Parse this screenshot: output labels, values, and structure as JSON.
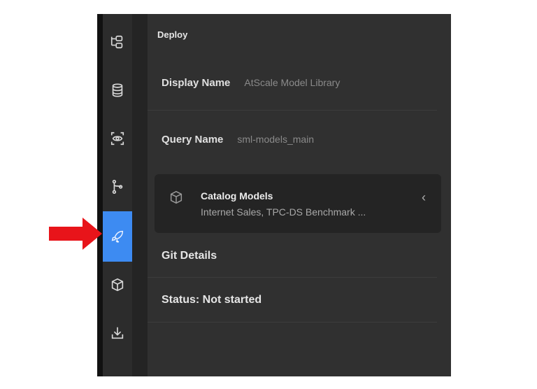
{
  "sidebar": {
    "items": [
      {
        "icon": "diagram-icon",
        "active": false
      },
      {
        "icon": "database-icon",
        "active": false
      },
      {
        "icon": "preview-eye-icon",
        "active": false
      },
      {
        "icon": "git-branch-icon",
        "active": false
      },
      {
        "icon": "rocket-icon",
        "active": true
      },
      {
        "icon": "package-icon",
        "active": false
      },
      {
        "icon": "download-icon",
        "active": false
      }
    ],
    "active_color": "#3d8bf2"
  },
  "panel": {
    "title": "Deploy",
    "fields": [
      {
        "label": "Display Name",
        "value": "AtScale Model Library"
      },
      {
        "label": "Query Name",
        "value": "sml-models_main"
      }
    ],
    "catalog": {
      "title": "Catalog Models",
      "subtitle": "Internet Sales, TPC-DS Benchmark ...",
      "chevron": "‹",
      "icon": "cube-icon"
    },
    "git_details": "Git Details",
    "status": "Status: Not started"
  },
  "annotation": {
    "color": "#e8141a",
    "icon": "red-arrow-pointer"
  }
}
